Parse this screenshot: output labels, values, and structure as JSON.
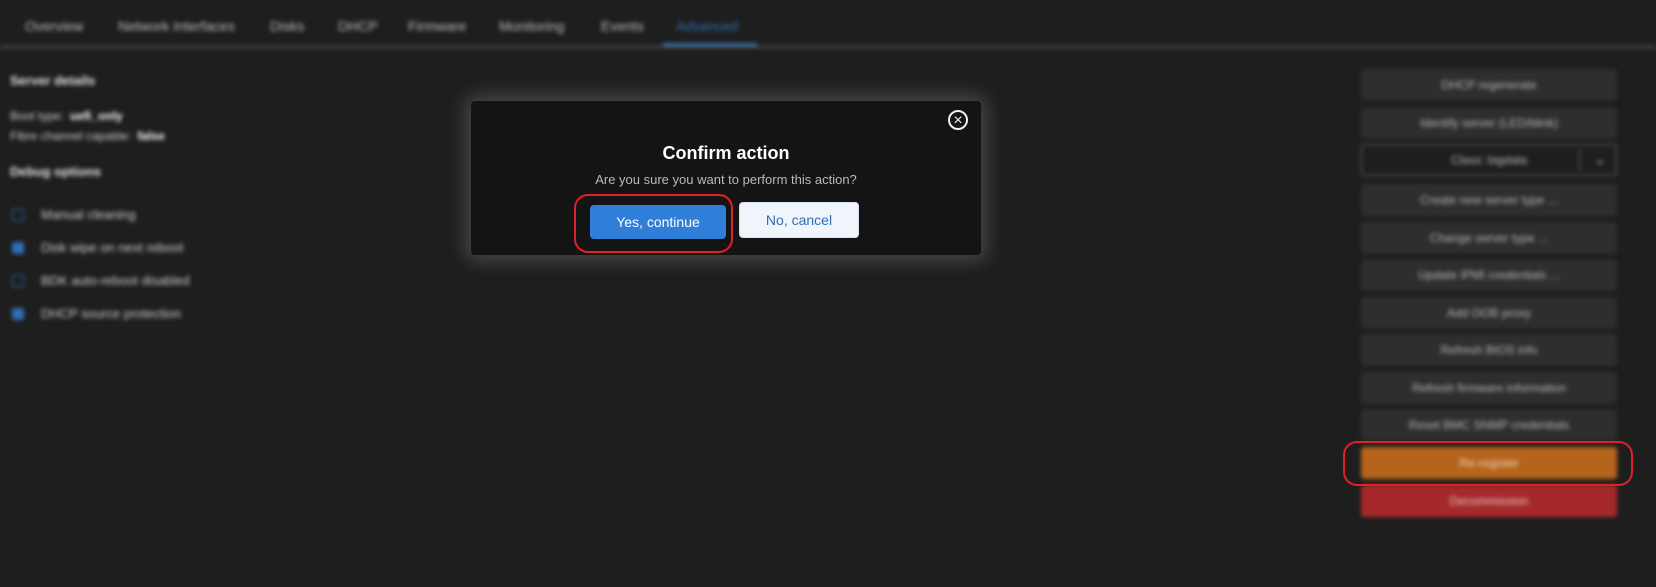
{
  "tabs": [
    "Overview",
    "Network Interfaces",
    "Disks",
    "DHCP",
    "Firmware",
    "Monitoring",
    "Events",
    "Advanced"
  ],
  "active_tab": "Advanced",
  "server_details": {
    "title": "Server details",
    "boot_type_label": "Boot type:",
    "boot_type_value": "uefi_only",
    "fibre_label": "Fibre channel capable:",
    "fibre_value": "false"
  },
  "debug_options": {
    "title": "Debug options",
    "items": [
      {
        "label": "Manual cleaning",
        "checked": false
      },
      {
        "label": "Disk wipe on next reboot",
        "checked": true
      },
      {
        "label": "BDK auto-reboot disabled",
        "checked": false
      },
      {
        "label": "DHCP source protection",
        "checked": true
      }
    ]
  },
  "actions": {
    "dhcp_regenerate": "DHCP regenerate",
    "identify_server": "Identify server (LED/blink)",
    "class_select": "Class: bigdata",
    "create_server_type": "Create new server type ...",
    "change_server_type": "Change server type ...",
    "update_ipmi": "Update IPMI credentials ...",
    "add_oob_proxy": "Add OOB proxy",
    "refresh_bios": "Refresh BIOS info",
    "refresh_firmware": "Refresh firmware information",
    "reset_bmc_snmp": "Reset BMC SNMP credentials",
    "re_register": "Re-register",
    "decommission": "Decommission"
  },
  "modal": {
    "title": "Confirm action",
    "message": "Are you sure you want to perform this action?",
    "confirm_label": "Yes, continue",
    "cancel_label": "No, cancel",
    "close_icon": "×"
  },
  "colors": {
    "accent": "#2f7fd8",
    "warn": "#b5641b",
    "danger": "#a6292a",
    "highlight_ring": "#e0202a"
  }
}
